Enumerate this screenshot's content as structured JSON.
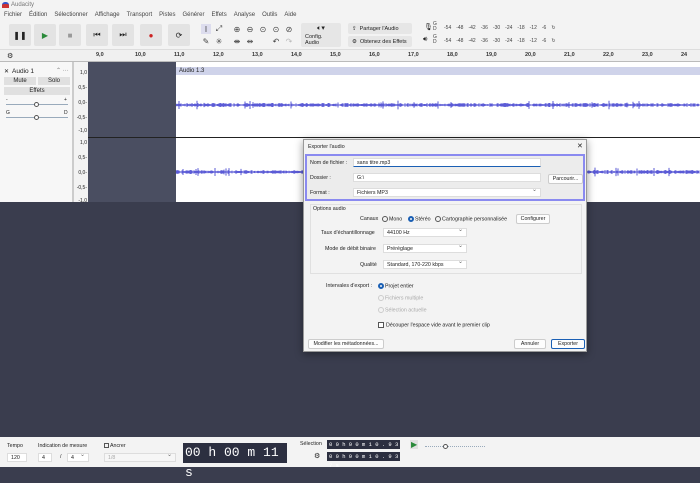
{
  "app": {
    "title": "Audacity"
  },
  "menu": [
    "Fichier",
    "Édition",
    "Sélectionner",
    "Affichage",
    "Transport",
    "Pistes",
    "Générer",
    "Effets",
    "Analyse",
    "Outils",
    "Aide"
  ],
  "toolbar": {
    "audio_setup": "Config. Audio",
    "share_audio": "Partager l'Audio",
    "get_effects": "Obtenez des Effets",
    "meter_ticks": [
      "-54",
      "-48",
      "-42",
      "-36",
      "-30",
      "-24",
      "-18",
      "-12",
      "-6"
    ],
    "meter_channels": [
      "G",
      "D"
    ]
  },
  "ruler": {
    "ticks": [
      "9,0",
      "10,0",
      "11,0",
      "12,0",
      "13,0",
      "14,0",
      "15,0",
      "16,0",
      "17,0",
      "18,0",
      "19,0",
      "20,0",
      "21,0",
      "22,0",
      "23,0",
      "24"
    ]
  },
  "track": {
    "name": "Audio 1",
    "mute": "Mute",
    "solo": "Solo",
    "effects": "Effets",
    "gain_min": "-",
    "gain_max": "+",
    "pan_left": "G",
    "pan_right": "D",
    "scale": [
      "1,0",
      "0,5-",
      "0,0-",
      "-0,5-",
      "-1,0"
    ],
    "clip_name": "Audio 1.3"
  },
  "dialog": {
    "title": "Exporter l'audio",
    "filename_label": "Nom de fichier :",
    "filename_value": "sans titre.mp3",
    "folder_label": "Dossier :",
    "folder_value": "G:\\",
    "browse": "Parcourir...",
    "format_label": "Format :",
    "format_value": "Fichiers MP3",
    "audio_options": "Options audio",
    "channels_label": "Canaux",
    "mono": "Mono",
    "stereo": "Stéréo",
    "custom_mapping": "Cartographie personnalisée",
    "configure": "Configurer",
    "sample_rate_label": "Taux d'échantillonnage",
    "sample_rate_value": "44100 Hz",
    "bitrate_mode_label": "Mode de débit binaire",
    "bitrate_mode_value": "Préréglage",
    "quality_label": "Qualité",
    "quality_value": "Standard, 170-220 kbps",
    "range_label": "Intervales d'export :",
    "range_project": "Projet entier",
    "range_multiple": "Fichiers multiple",
    "range_selection": "Sélection actuelle",
    "trim_label": "Découper l'espace vide avant le premier clip",
    "trim_checked": false,
    "metadata": "Modifier les métadonnées...",
    "cancel": "Annuler",
    "export": "Exporter",
    "selected_channel": "Stéréo",
    "selected_range": "Projet entier"
  },
  "bottom": {
    "tempo_label": "Tempo",
    "tempo_value": "120",
    "time_sig_label": "Indication de mesure",
    "time_sig_num": "4",
    "time_sig_den": "4",
    "snap_label": "Ancrer",
    "snap_value": "1/8",
    "time_display": "00 h 00 m 11 s",
    "selection_label": "Sélection",
    "sel_start": "0 0 h 0 0 m 1 0 . 9 3 7 s",
    "sel_end": "0 0 h 0 0 m 1 0 . 9 3 7 s"
  },
  "colors": {
    "accent": "#1a5fb4",
    "highlight": "#8a8af0",
    "waveform": "#5b5bd6",
    "track_bg": "#4a4e61"
  }
}
